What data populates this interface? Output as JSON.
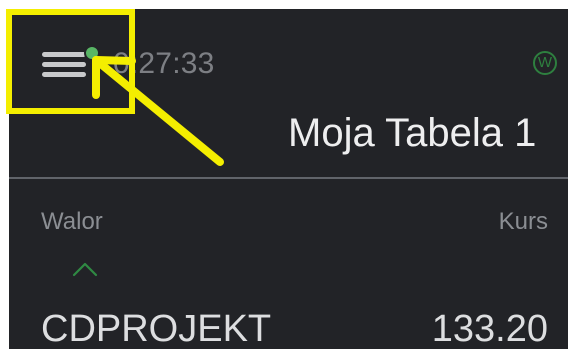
{
  "header": {
    "menu_icon": "hamburger-menu-icon",
    "notification_dot_color": "#58b565",
    "clock": "0:27:33",
    "badge_label": "W",
    "badge_color": "#2e7f3f"
  },
  "table": {
    "title": "Moja Tabela 1",
    "columns": {
      "walor": "Walor",
      "kurs": "Kurs"
    },
    "sort_icon": "chevron-up-icon",
    "rows": [
      {
        "name": "CDPROJEKT",
        "price": "133.20"
      }
    ]
  },
  "annotation": {
    "highlight_color": "#f4ee00",
    "arrow_icon": "pointer-arrow-icon"
  },
  "theme": {
    "background": "#222327",
    "divider": "#61646a"
  }
}
